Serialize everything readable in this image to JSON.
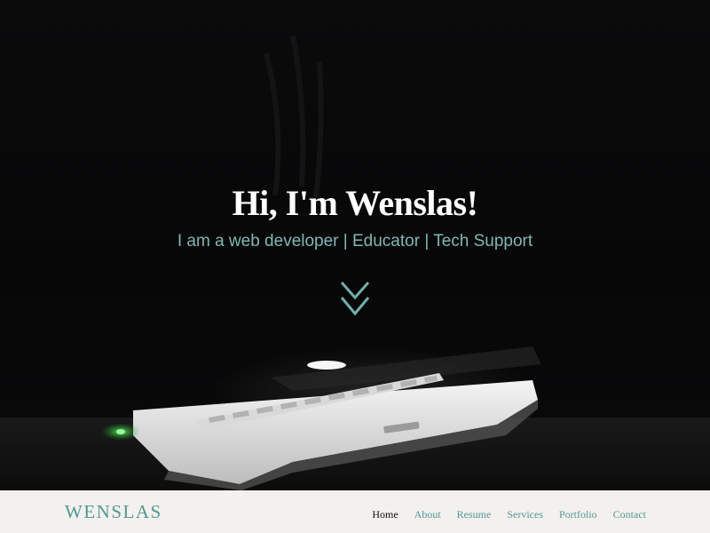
{
  "hero": {
    "title": "Hi, I'm Wenslas!",
    "subtitle": "I am a web developer | Educator | Tech Support",
    "scroll_icon": "double-chevron-down"
  },
  "navbar": {
    "brand": "WENSLAS",
    "links": [
      {
        "label": "Home",
        "active": true
      },
      {
        "label": "About",
        "active": false
      },
      {
        "label": "Resume",
        "active": false
      },
      {
        "label": "Services",
        "active": false
      },
      {
        "label": "Portfolio",
        "active": false
      },
      {
        "label": "Contact",
        "active": false
      }
    ]
  },
  "colors": {
    "accent": "#4f9a94",
    "subtitle": "#7fb8b2",
    "navbar_bg": "#f3f0ee",
    "hero_bg": "#070708"
  }
}
